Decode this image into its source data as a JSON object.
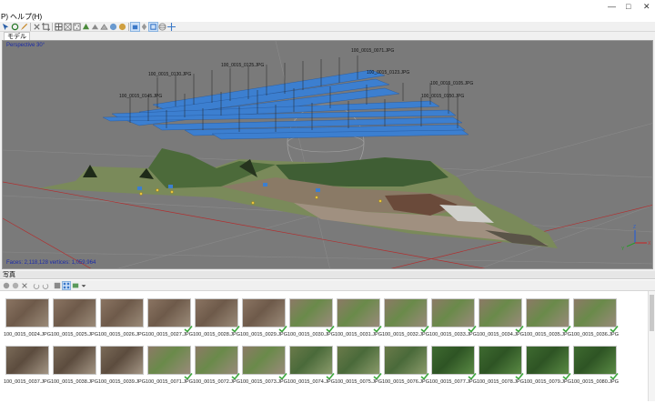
{
  "menu": {
    "items": [
      "P)",
      "ヘルプ(H)"
    ]
  },
  "window": {
    "minimize": "—",
    "maximize": "□",
    "close": "✕"
  },
  "tabs": {
    "model": "モデル"
  },
  "viewport": {
    "projection_label": "Perspective 30°",
    "status": "Faces: 2,118,128 vertices: 1,059,964"
  },
  "camera_labels": [
    "100_0015_0071.JPG",
    "100_0015_0123.JPG",
    "100_0015_0125.JPG",
    "100_0015_0130.JPG",
    "100_0015_0105.JPG",
    "100_0015_0145.JPG",
    "100_0015_0150.JPG"
  ],
  "axes": {
    "x": "X",
    "y": "Y",
    "z": "Z"
  },
  "photos_panel": {
    "title": "写真",
    "rows": [
      [
        "100_0015_0024.JPG",
        "100_0015_0025.JPG",
        "100_0015_0026.JPG",
        "100_0015_0027.JPG",
        "100_0015_0028.JPG",
        "100_0015_0029.JPG",
        "100_0015_0030.JPG",
        "100_0015_0031.JPG",
        "100_0015_0032.JPG",
        "100_0015_0033.JPG",
        "100_0015_0034.JPG",
        "100_0015_0035.JPG",
        "100_0015_0036.JPG"
      ],
      [
        "100_0015_0037.JPG",
        "100_0015_0038.JPG",
        "100_0015_0039.JPG",
        "100_0015_0071.JPG",
        "100_0015_0072.JPG",
        "100_0015_0073.JPG",
        "100_0015_0074.JPG",
        "100_0015_0075.JPG",
        "100_0015_0076.JPG",
        "100_0015_0077.JPG",
        "100_0015_0078.JPG",
        "100_0015_0079.JPG",
        "100_0015_0080.JPG"
      ]
    ],
    "badges_row1": [
      false,
      false,
      false,
      true,
      true,
      true,
      true,
      true,
      true,
      true,
      true,
      true,
      true
    ],
    "badges_row2": [
      false,
      false,
      false,
      true,
      true,
      true,
      true,
      true,
      true,
      true,
      true,
      true,
      true
    ]
  },
  "colors": {
    "accent": "#3a78c8",
    "viewport_bg": "#7a7a7a",
    "camera_plane": "#3c7fd0"
  }
}
